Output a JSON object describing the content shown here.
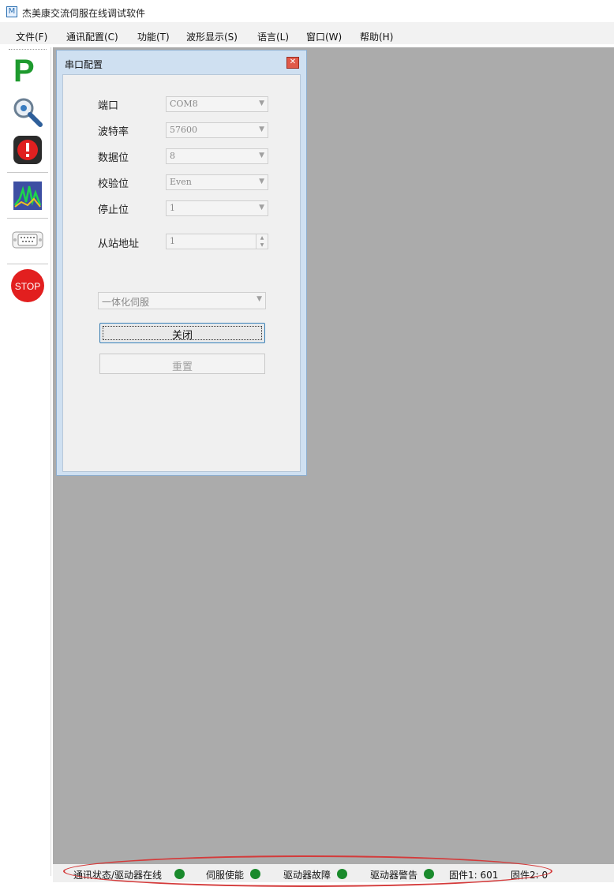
{
  "window": {
    "title": "杰美康交流伺服在线调试软件"
  },
  "menu": [
    "文件(F)",
    "通讯配置(C)",
    "功能(T)",
    "波形显示(S)",
    "语言(L)",
    "窗口(W)",
    "帮助(H)"
  ],
  "toolbar": {
    "p_label": "P",
    "stop_label": "STOP"
  },
  "dialog": {
    "title": "串口配置",
    "port_label": "端口",
    "port_value": "COM8",
    "baud_label": "波特率",
    "baud_value": "57600",
    "databits_label": "数据位",
    "databits_value": "8",
    "parity_label": "校验位",
    "parity_value": "Even",
    "stopbits_label": "停止位",
    "stopbits_value": "1",
    "slave_label": "从站地址",
    "slave_value": "1",
    "device_value": "一体化伺服",
    "close_button": "关闭",
    "reset_button": "重置"
  },
  "status": {
    "comm": "通讯状态/驱动器在线",
    "servo": "伺服使能",
    "fault": "驱动器故障",
    "warning": "驱动器警告",
    "fw1": "固件1: 601",
    "fw2": "固件2: 0",
    "led_color": "#1a8a2c",
    "oval_color": "#d43a3a"
  }
}
